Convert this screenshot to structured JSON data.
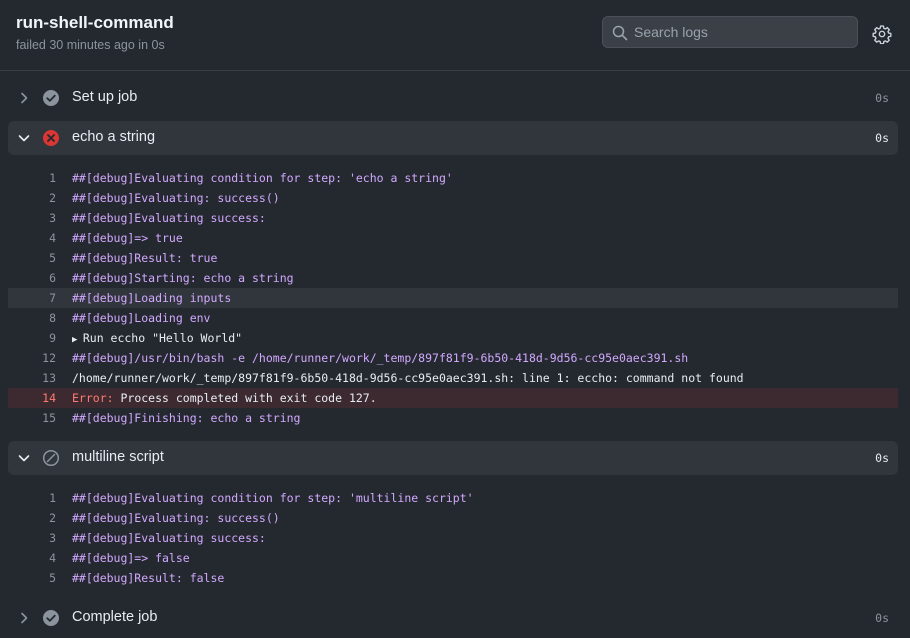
{
  "header": {
    "title": "run-shell-command",
    "subtitle": "failed 30 minutes ago in 0s"
  },
  "search": {
    "placeholder": "Search logs",
    "value": ""
  },
  "colors": {
    "debug": "#d2a8ff",
    "error": "#ff7b72",
    "failure_icon": "#da3633",
    "background": "#24292f"
  },
  "steps": [
    {
      "name": "Set up job",
      "duration": "0s",
      "status": "success",
      "expanded": false
    },
    {
      "name": "echo a string",
      "duration": "0s",
      "status": "failure",
      "expanded": true
    },
    {
      "name": "multiline script",
      "duration": "0s",
      "status": "skipped",
      "expanded": true
    },
    {
      "name": "Complete job",
      "duration": "0s",
      "status": "success",
      "expanded": false
    }
  ],
  "echo_logs": [
    {
      "n": "1",
      "text": "##[debug]Evaluating condition for step: 'echo a string'",
      "kind": "debug"
    },
    {
      "n": "2",
      "text": "##[debug]Evaluating: success()",
      "kind": "debug"
    },
    {
      "n": "3",
      "text": "##[debug]Evaluating success:",
      "kind": "debug"
    },
    {
      "n": "4",
      "text": "##[debug]=> true",
      "kind": "debug"
    },
    {
      "n": "5",
      "text": "##[debug]Result: true",
      "kind": "debug"
    },
    {
      "n": "6",
      "text": "##[debug]Starting: echo a string",
      "kind": "debug"
    },
    {
      "n": "7",
      "text": "##[debug]Loading inputs",
      "kind": "debug",
      "highlighted": true
    },
    {
      "n": "8",
      "text": "##[debug]Loading env",
      "kind": "debug"
    },
    {
      "n": "9",
      "text": "Run eccho \"Hello World\"",
      "kind": "group"
    },
    {
      "n": "12",
      "text": "##[debug]/usr/bin/bash -e /home/runner/work/_temp/897f81f9-6b50-418d-9d56-cc95e0aec391.sh",
      "kind": "debug"
    },
    {
      "n": "13",
      "text": "/home/runner/work/_temp/897f81f9-6b50-418d-9d56-cc95e0aec391.sh: line 1: eccho: command not found",
      "kind": "plain"
    },
    {
      "n": "14",
      "label": "Error:",
      "text": " Process completed with exit code 127.",
      "kind": "error"
    },
    {
      "n": "15",
      "text": "##[debug]Finishing: echo a string",
      "kind": "debug"
    }
  ],
  "multiline_logs": [
    {
      "n": "1",
      "text": "##[debug]Evaluating condition for step: 'multiline script'",
      "kind": "debug"
    },
    {
      "n": "2",
      "text": "##[debug]Evaluating: success()",
      "kind": "debug"
    },
    {
      "n": "3",
      "text": "##[debug]Evaluating success:",
      "kind": "debug"
    },
    {
      "n": "4",
      "text": "##[debug]=> false",
      "kind": "debug"
    },
    {
      "n": "5",
      "text": "##[debug]Result: false",
      "kind": "debug"
    }
  ]
}
